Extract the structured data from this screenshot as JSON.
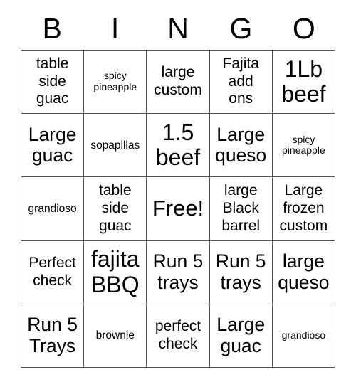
{
  "card": {
    "headers": [
      "B",
      "I",
      "N",
      "G",
      "O"
    ],
    "free_space_label": "Free!",
    "grid_line_color": "#555555",
    "background_color": "#ffffff",
    "text_color": "#000000",
    "rows": [
      [
        {
          "text": "table\nside\nguac",
          "size": "md"
        },
        {
          "text": "spicy\npineapple",
          "size": "xs"
        },
        {
          "text": "large\ncustom",
          "size": "md"
        },
        {
          "text": "Fajita\nadd\nons",
          "size": "md"
        },
        {
          "text": "1Lb\nbeef",
          "size": "xl"
        }
      ],
      [
        {
          "text": "Large\nguac",
          "size": "lg"
        },
        {
          "text": "sopapillas",
          "size": "sm"
        },
        {
          "text": "1.5\nbeef",
          "size": "xl"
        },
        {
          "text": "Large\nqueso",
          "size": "lg"
        },
        {
          "text": "spicy\npineapple",
          "size": "xs"
        }
      ],
      [
        {
          "text": "grandioso",
          "size": "sm"
        },
        {
          "text": "table\nside\nguac",
          "size": "md"
        },
        {
          "text": "Free!",
          "size": "free"
        },
        {
          "text": "large\nBlack\nbarrel",
          "size": "md"
        },
        {
          "text": "Large\nfrozen\ncustom",
          "size": "md"
        }
      ],
      [
        {
          "text": "Perfect\ncheck",
          "size": "md"
        },
        {
          "text": "fajita\nBBQ",
          "size": "xl"
        },
        {
          "text": "Run 5\ntrays",
          "size": "lg"
        },
        {
          "text": "Run 5\ntrays",
          "size": "lg"
        },
        {
          "text": "large\nqueso",
          "size": "lg"
        }
      ],
      [
        {
          "text": "Run 5\nTrays",
          "size": "lg"
        },
        {
          "text": "brownie",
          "size": "sm"
        },
        {
          "text": "perfect\ncheck",
          "size": "md"
        },
        {
          "text": "Large\nguac",
          "size": "lg"
        },
        {
          "text": "grandioso",
          "size": "xs"
        }
      ]
    ]
  }
}
